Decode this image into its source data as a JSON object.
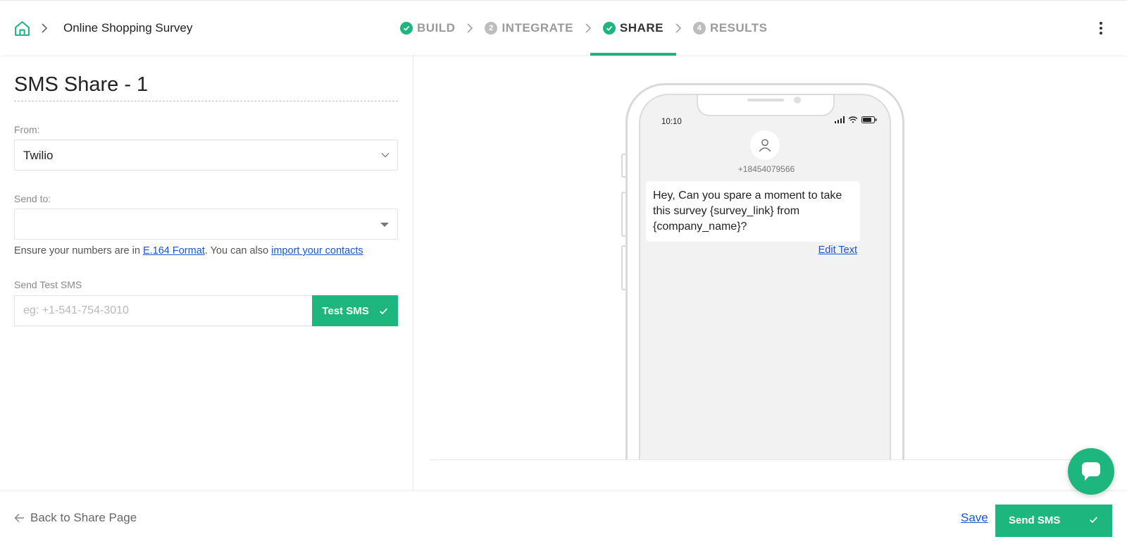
{
  "header": {
    "survey_title": "Online Shopping Survey",
    "steps": [
      {
        "label": "BUILD",
        "badge": "",
        "state": "done"
      },
      {
        "label": "INTEGRATE",
        "badge": "2",
        "state": "pending"
      },
      {
        "label": "SHARE",
        "badge": "",
        "state": "active"
      },
      {
        "label": "RESULTS",
        "badge": "4",
        "state": "pending"
      }
    ]
  },
  "form": {
    "title": "SMS Share - 1",
    "from_label": "From:",
    "from_value": "Twilio",
    "send_to_label": "Send to:",
    "send_to_value": "",
    "helper_prefix": "Ensure your numbers are in ",
    "helper_link1": "E.164 Format",
    "helper_middle": ". You can also ",
    "helper_link2": "import your contacts",
    "test_label": "Send Test SMS",
    "test_placeholder": "eg: +1-541-754-3010",
    "test_button": "Test SMS"
  },
  "preview": {
    "time": "10:10",
    "sender_number": "+18454079566",
    "message": "Hey, Can you spare a moment to take this survey {survey_link} from {company_name}?",
    "edit_text": "Edit Text"
  },
  "footer": {
    "back_label": "Back to Share Page",
    "save_label": "Save",
    "send_label": "Send SMS"
  },
  "colors": {
    "accent": "#1db67e",
    "link": "#1a55c9",
    "muted": "#9a9a9a"
  }
}
